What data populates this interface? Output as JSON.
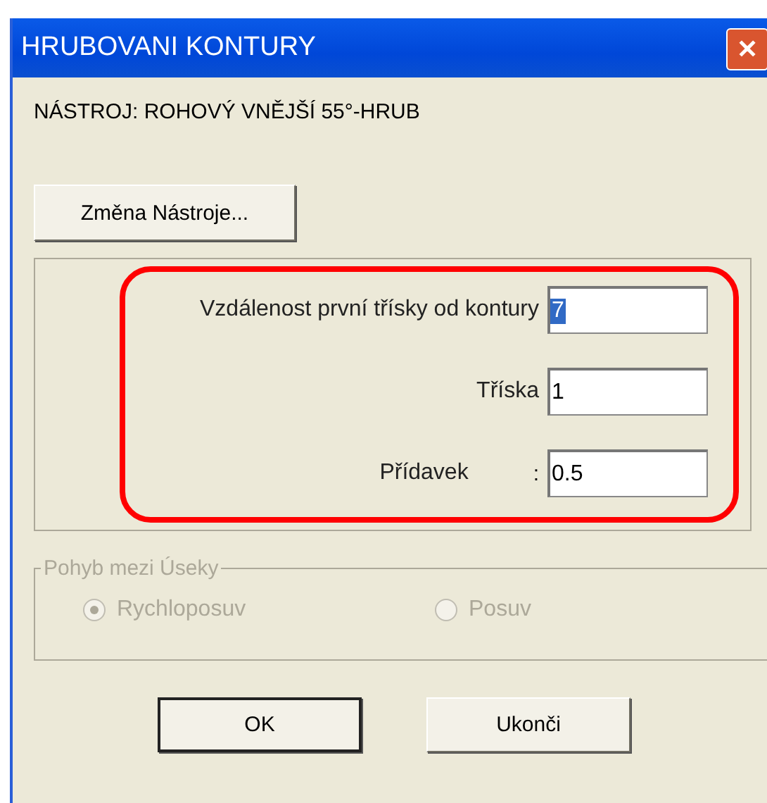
{
  "window": {
    "title": "HRUBOVANI KONTURY",
    "close": "✕"
  },
  "tool_label": "NÁSTROJ: ROHOVÝ VNĚJŠÍ 55°-HRUB",
  "change_tool_button": "Změna Nástroje...",
  "fields": [
    {
      "label": "Vzdálenost první třísky od kontury",
      "value": "7",
      "selected": true,
      "highlighted": true
    },
    {
      "label": "Tříska",
      "value": "1",
      "selected": false,
      "highlighted": true
    },
    {
      "label": "Přídavek",
      "separator": ":",
      "value": "0.5",
      "selected": false,
      "highlighted": true
    }
  ],
  "movement_group": {
    "title": "Pohyb mezi Úseky",
    "disabled": true,
    "options": [
      {
        "label": "Rychloposuv",
        "selected": true
      },
      {
        "label": "Posuv",
        "selected": false
      }
    ]
  },
  "buttons": [
    {
      "label": "OK",
      "default": true
    },
    {
      "label": "Ukonči",
      "default": false
    }
  ]
}
